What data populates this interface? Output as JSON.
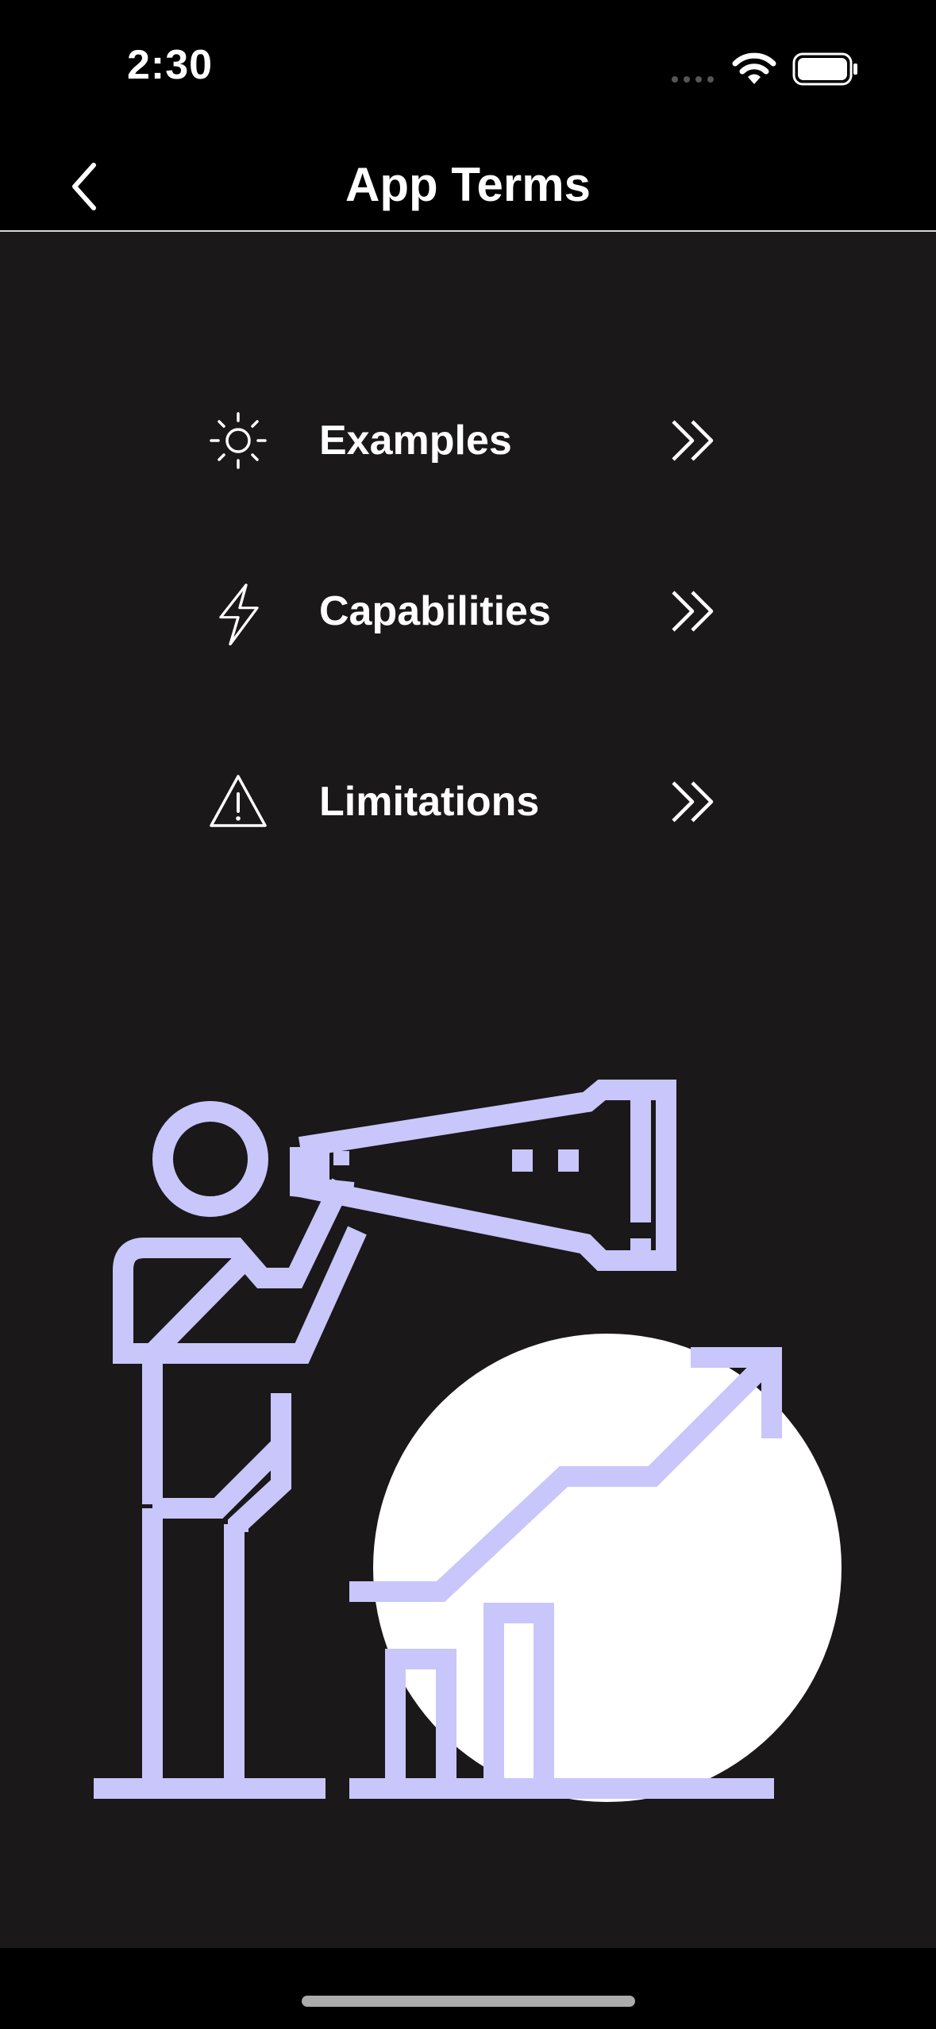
{
  "status_bar": {
    "time": "2:30"
  },
  "nav": {
    "title": "App Terms",
    "back_icon": "chevron-left-icon"
  },
  "menu": [
    {
      "label": "Examples",
      "icon": "sun-icon"
    },
    {
      "label": "Capabilities",
      "icon": "lightning-icon"
    },
    {
      "label": "Limitations",
      "icon": "warning-icon"
    }
  ],
  "colors": {
    "background": "#1a1818",
    "bars": "#000000",
    "illustration": "#c8c6fa",
    "circle": "#ffffff",
    "text": "#ffffff"
  }
}
